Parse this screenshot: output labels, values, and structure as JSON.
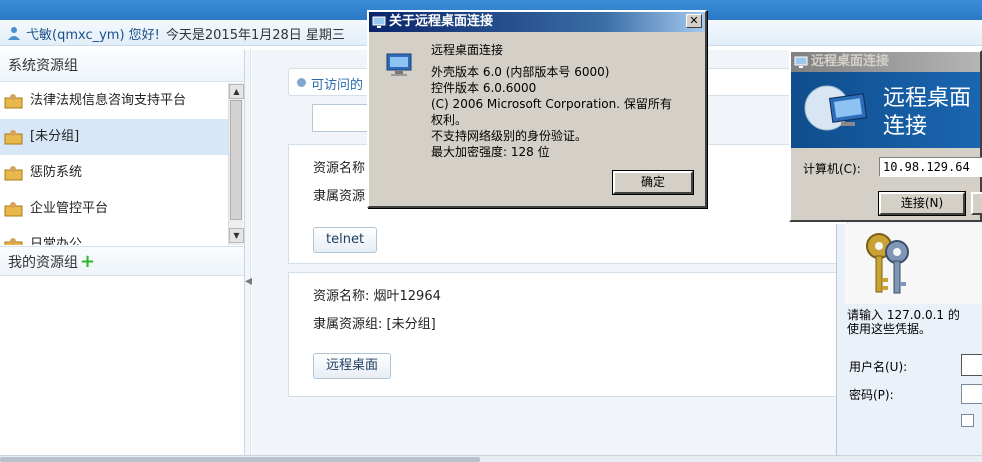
{
  "header": {
    "greeting": "弋敏(qmxc_ym) 您好!",
    "date": "今天是2015年1月28日 星期三"
  },
  "left_panel": {
    "group_title": "系统资源组",
    "tree_items": [
      {
        "label": "法律法规信息咨询支持平台",
        "selected": false
      },
      {
        "label": "[未分组]",
        "selected": true
      },
      {
        "label": "惩防系统",
        "selected": false
      },
      {
        "label": "企业管控平台",
        "selected": false
      },
      {
        "label": "日常办公",
        "selected": false
      }
    ],
    "my_groups_label": "我的资源组",
    "scroll_up": "▲",
    "scroll_down": "▼"
  },
  "main": {
    "access_header": "可访问的",
    "card1": {
      "name_label": "资源名称",
      "group_label": "隶属资源",
      "button": "telnet"
    },
    "card2": {
      "name": "资源名称: 烟叶12964",
      "group": "隶属资源组: [未分组]",
      "button": "远程桌面"
    }
  },
  "about_dialog": {
    "title": "关于远程桌面连接",
    "app_name": "远程桌面连接",
    "shell_version": "外壳版本 6.0 (内部版本号 6000)",
    "control_version": "控件版本 6.0.6000",
    "copyright_line1": "(C) 2006 Microsoft Corporation. 保留所有",
    "copyright_line2": "权利。",
    "nla_note": "不支持网络级别的身份验证。",
    "encryption": "最大加密强度: 128 位",
    "ok_button": "确定",
    "close_glyph": "✕"
  },
  "rdp_window": {
    "title": "远程桌面连接",
    "banner_line1": "远程桌面",
    "banner_line2": "连接",
    "computer_label": "计算机(C):",
    "computer_value": "10.98.129.64",
    "connect_button": "连接(N)"
  },
  "credential_panel": {
    "prompt_line1": "请输入 127.0.0.1 的",
    "prompt_line2": "使用这些凭据。",
    "username_label": "用户名(U):",
    "password_label": "密码(P):"
  },
  "icons": {
    "user": "user-icon",
    "folder": "folder-user-icon",
    "add": "plus-icon",
    "rdp": "remote-desktop-icon",
    "keys": "keys-icon"
  },
  "colors": {
    "accent_blue": "#2a78c4",
    "dialog_title": "#0a246a",
    "add_green": "#2eb82e"
  }
}
